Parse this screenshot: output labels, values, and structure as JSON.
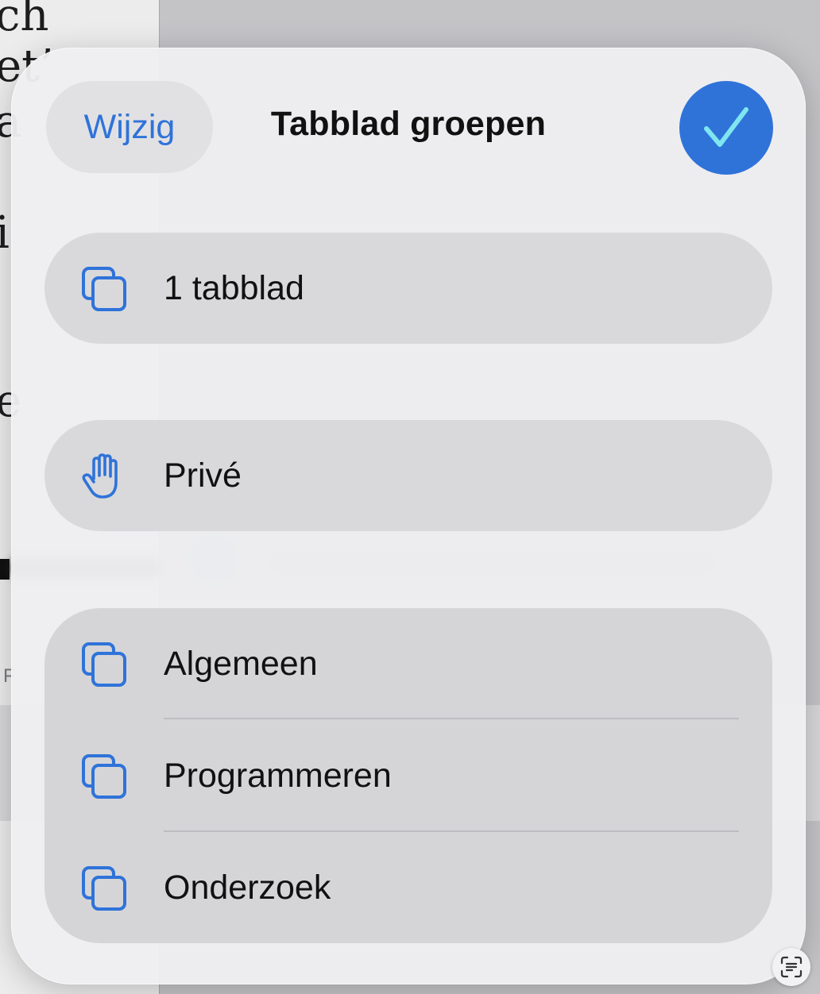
{
  "background": {
    "fragments": [
      "ch",
      "et’",
      "a",
      "i",
      "e"
    ],
    "small_letter": "F"
  },
  "popover": {
    "edit_label": "Wijzig",
    "title": "Tabblad groepen",
    "done_icon": "checkmark-icon",
    "current": {
      "label": "1 tabblad",
      "icon": "tabs-icon"
    },
    "private": {
      "label": "Privé",
      "icon": "hand-raised-icon"
    },
    "groups": [
      {
        "label": "Algemeen",
        "icon": "tabs-icon"
      },
      {
        "label": "Programmeren",
        "icon": "tabs-icon"
      },
      {
        "label": "Onderzoek",
        "icon": "tabs-icon"
      }
    ]
  },
  "corner_button": {
    "icon": "live-text-scan-icon"
  },
  "colors": {
    "accent": "#2f73d9",
    "checkmark": "#7fe6f0"
  }
}
